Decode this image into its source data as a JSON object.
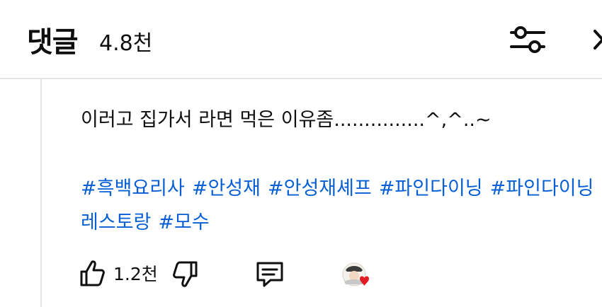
{
  "header": {
    "title": "댓글",
    "comment_count": "4.8천"
  },
  "comment": {
    "text": "이러고 집가서 라면 먹은 이유좀...............^,^..~",
    "hashtags": [
      "#흑백요리사",
      "#안성재",
      "#안성재셰프",
      "#파인다이닝",
      "#파인다이닝레스토랑",
      "#모수"
    ],
    "like_count": "1.2천"
  },
  "colors": {
    "link": "#065fd4",
    "divider": "#e5e5e5",
    "heart": "#e01b24"
  },
  "icons": [
    "sliders-icon",
    "close-icon",
    "thumbs-up-icon",
    "thumbs-down-icon",
    "reply-icon",
    "creator-heart-icon"
  ]
}
